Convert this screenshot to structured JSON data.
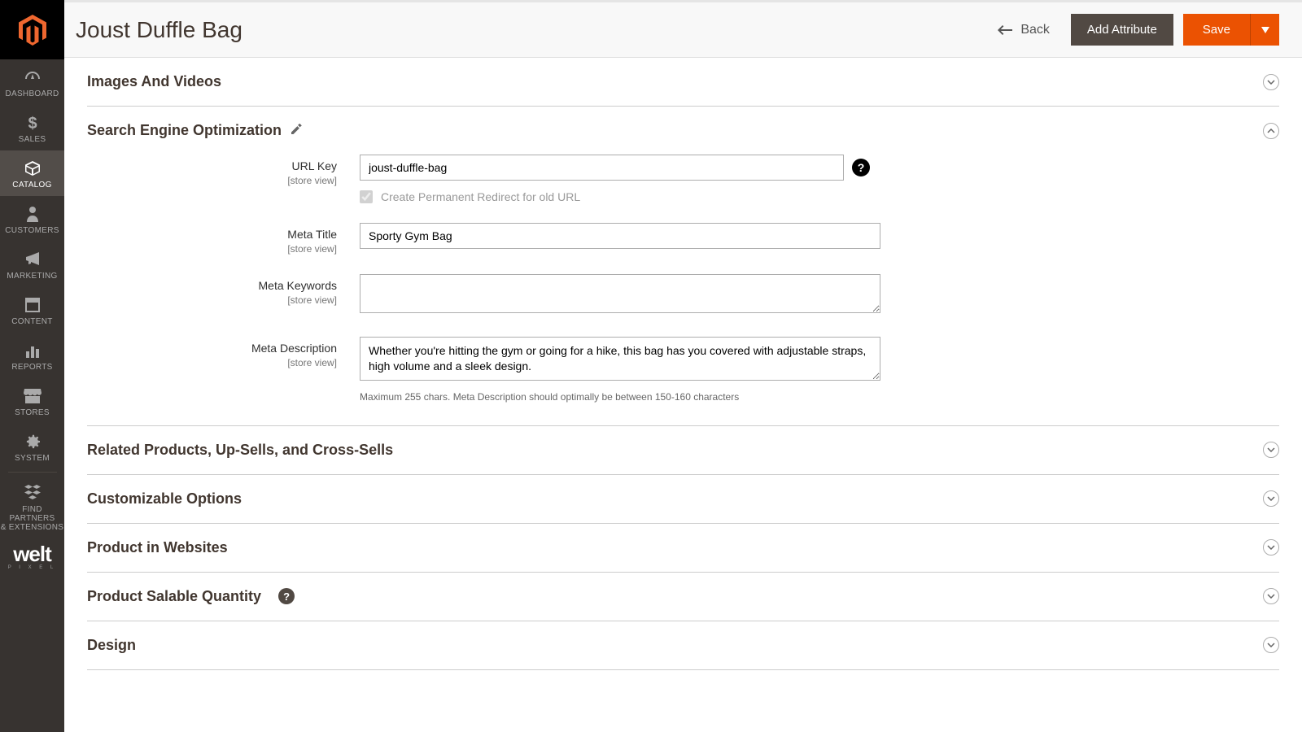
{
  "sidebar": {
    "items": [
      {
        "label": "DASHBOARD",
        "icon": "dashboard"
      },
      {
        "label": "SALES",
        "icon": "dollar"
      },
      {
        "label": "CATALOG",
        "icon": "cube",
        "active": true
      },
      {
        "label": "CUSTOMERS",
        "icon": "person"
      },
      {
        "label": "MARKETING",
        "icon": "megaphone"
      },
      {
        "label": "CONTENT",
        "icon": "layout"
      },
      {
        "label": "REPORTS",
        "icon": "bars"
      },
      {
        "label": "STORES",
        "icon": "storefront"
      },
      {
        "label": "SYSTEM",
        "icon": "gear"
      },
      {
        "label": "FIND PARTNERS\n& EXTENSIONS",
        "icon": "blocks"
      }
    ],
    "brand": {
      "text": "welt",
      "sub": "P I X E L"
    }
  },
  "header": {
    "title": "Joust Duffle Bag",
    "back_label": "Back",
    "add_attribute_label": "Add Attribute",
    "save_label": "Save"
  },
  "sections": {
    "images": {
      "title": "Images And Videos",
      "expanded": false
    },
    "seo": {
      "title": "Search Engine Optimization",
      "expanded": true,
      "fields": {
        "url_key": {
          "label": "URL Key",
          "scope": "[store view]",
          "value": "joust-duffle-bag"
        },
        "redirect": {
          "label": "Create Permanent Redirect for old URL",
          "checked": true,
          "disabled": true
        },
        "meta_title": {
          "label": "Meta Title",
          "scope": "[store view]",
          "value": "Sporty Gym Bag"
        },
        "meta_keywords": {
          "label": "Meta Keywords",
          "scope": "[store view]",
          "value": ""
        },
        "meta_description": {
          "label": "Meta Description",
          "scope": "[store view]",
          "value": "Whether you're hitting the gym or going for a hike, this bag has you covered with adjustable straps, high volume and a sleek design.",
          "note": "Maximum 255 chars. Meta Description should optimally be between 150-160 characters"
        }
      }
    },
    "related": {
      "title": "Related Products, Up-Sells, and Cross-Sells",
      "expanded": false
    },
    "customizable": {
      "title": "Customizable Options",
      "expanded": false
    },
    "websites": {
      "title": "Product in Websites",
      "expanded": false
    },
    "salable": {
      "title": "Product Salable Quantity",
      "expanded": false,
      "help": true
    },
    "design": {
      "title": "Design",
      "expanded": false
    }
  }
}
